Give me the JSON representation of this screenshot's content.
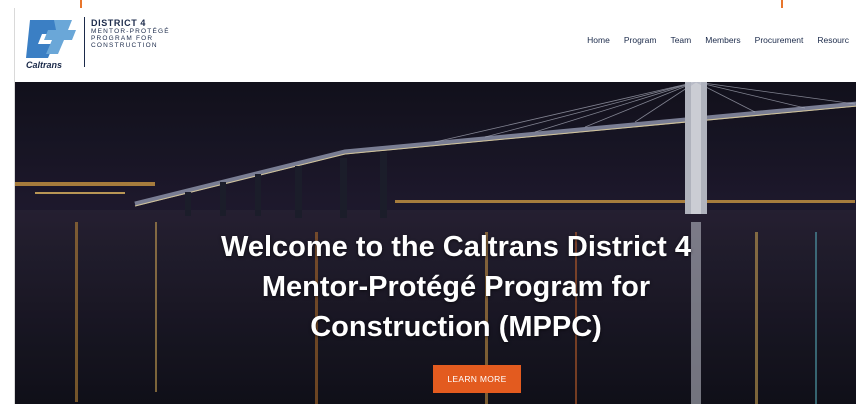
{
  "brand": {
    "wordmark": "Caltrans",
    "title": "DISTRICT 4",
    "subtitle_lines": [
      "MENTOR-PROTÉGÉ",
      "PROGRAM FOR",
      "CONSTRUCTION"
    ],
    "primary_color": "#1b2a4a",
    "logo_color": "#3b7fc4"
  },
  "nav": {
    "items": [
      "Home",
      "Program",
      "Team",
      "Members",
      "Procurement",
      "Resourc"
    ]
  },
  "hero": {
    "heading_lines": [
      "Welcome to the Caltrans District 4",
      "Mentor-Protégé Program for",
      "Construction (MPPC)"
    ],
    "cta_label": "LEARN MORE",
    "cta_color": "#e35b1f",
    "background_description_icon": "bay-bridge-night-photo"
  },
  "accent_color": "#e8762c"
}
